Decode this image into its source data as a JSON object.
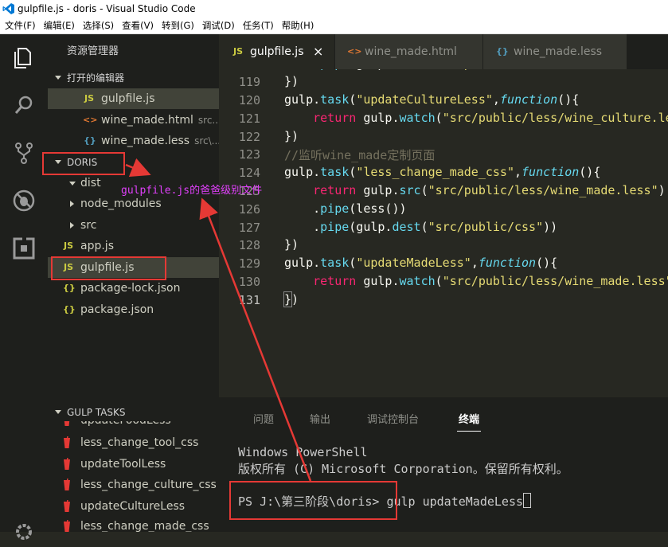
{
  "window": {
    "title": "gulpfile.js - doris - Visual Studio Code"
  },
  "menu": [
    "文件(F)",
    "编辑(E)",
    "选择(S)",
    "查看(V)",
    "转到(G)",
    "调试(D)",
    "任务(T)",
    "帮助(H)"
  ],
  "sidebar": {
    "header": "资源管理器",
    "open_editors": {
      "label": "打开的编辑器",
      "items": [
        {
          "icon": "JS",
          "name": "gulpfile.js",
          "desc": ""
        },
        {
          "icon": "<>",
          "name": "wine_made.html",
          "desc": "src..."
        },
        {
          "icon": "{}",
          "name": "wine_made.less",
          "desc": "src\\..."
        }
      ]
    },
    "project": {
      "label": "DORIS",
      "items": [
        {
          "name": "dist"
        },
        {
          "name": "node_modules"
        },
        {
          "name": "src"
        },
        {
          "icon": "JS",
          "name": "app.js"
        },
        {
          "icon": "JS",
          "name": "gulpfile.js"
        },
        {
          "icon": "{}",
          "name": "package-lock.json"
        },
        {
          "icon": "{}",
          "name": "package.json"
        }
      ]
    },
    "gulp_tasks": {
      "label": "GULP TASKS",
      "items": [
        "updateFoodLess",
        "less_change_tool_css",
        "updateToolLess",
        "less_change_culture_css",
        "updateCultureLess",
        "less_change_made_css"
      ]
    }
  },
  "tabs": [
    {
      "icon": "JS",
      "label": "gulpfile.js",
      "close": "×"
    },
    {
      "icon": "<>",
      "label": "wine_made.html"
    },
    {
      "icon": "{}",
      "label": "wine_made.less"
    }
  ],
  "editor": {
    "lines": [
      "119",
      "120",
      "121",
      "122",
      "123",
      "124",
      "125",
      "126",
      "127",
      "128",
      "129",
      "130",
      "131"
    ]
  },
  "panel": {
    "tabs": [
      "问题",
      "输出",
      "调试控制台",
      "终端"
    ],
    "terminal": {
      "line1": "Windows PowerShell",
      "line2": "版权所有 (C) Microsoft Corporation。保留所有权利。",
      "prompt": "PS J:\\第三阶段\\doris>",
      "command": "gulp updateMadeLess"
    }
  },
  "annotation": {
    "text": "gulpfile.js的爸爸级别文件"
  },
  "colors": {
    "accent_red": "#e53935",
    "annotation": "#e040fb",
    "background": "#272822"
  }
}
